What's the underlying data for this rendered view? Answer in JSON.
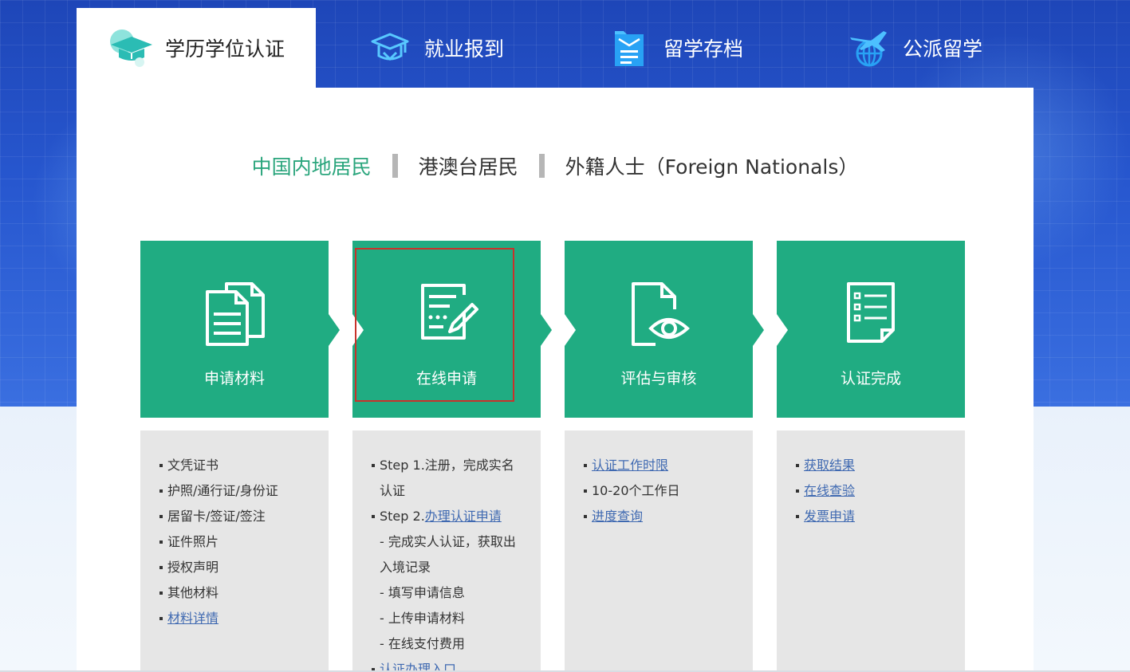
{
  "tabs": [
    {
      "label": "学历学位认证",
      "icon": "graduation-cap-icon",
      "active": true
    },
    {
      "label": "就业报到",
      "icon": "graduation-cap-outline-icon",
      "active": false
    },
    {
      "label": "留学存档",
      "icon": "document-folder-icon",
      "active": false
    },
    {
      "label": "公派留学",
      "icon": "airplane-globe-icon",
      "active": false
    }
  ],
  "regions": [
    {
      "label": "中国内地居民",
      "active": true
    },
    {
      "label": "港澳台居民",
      "active": false
    },
    {
      "label": "外籍人士（Foreign Nationals）",
      "active": false
    }
  ],
  "steps": [
    {
      "label": "申请材料",
      "icon": "documents-icon"
    },
    {
      "label": "在线申请",
      "icon": "form-edit-icon"
    },
    {
      "label": "评估与审核",
      "icon": "document-eye-icon"
    },
    {
      "label": "认证完成",
      "icon": "checklist-icon"
    }
  ],
  "materials": {
    "items": [
      "文凭证书",
      "护照/通行证/身份证",
      "居留卡/签证/签注",
      "证件照片",
      "授权声明",
      "其他材料"
    ],
    "link": "材料详情"
  },
  "online": {
    "step1a": "Step 1.注册，完成实名",
    "step1b": "认证",
    "step2_prefix": "Step 2.",
    "step2_link": "办理认证申请",
    "sub1a": "- 完成实人认证，获取出",
    "sub1b": "入境记录",
    "sub2": "- 填写申请信息",
    "sub3": "- 上传申请材料",
    "sub4": "- 在线支付费用",
    "entry_link": "认证办理入口"
  },
  "review": {
    "link1": "认证工作时限",
    "text": "10-20个工作日",
    "link2": "进度查询"
  },
  "complete": {
    "link1": "获取结果",
    "link2": "在线查验",
    "link3": "发票申请"
  },
  "colors": {
    "accent_green": "#20ac82",
    "active_region": "#2aa57c",
    "link_blue": "#3f69b1",
    "banner_blue": "#2757cf"
  }
}
